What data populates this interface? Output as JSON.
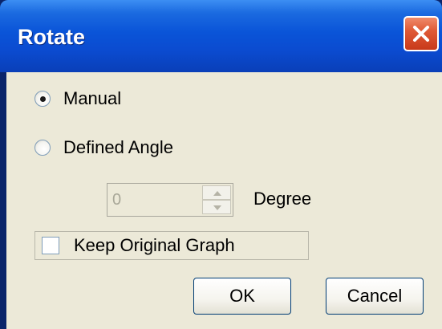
{
  "window": {
    "title": "Rotate",
    "close_icon": "close-x-icon",
    "accent_color": "#0a54d8",
    "close_color": "#e05a36"
  },
  "mode": {
    "options": [
      {
        "label": "Manual",
        "selected": true
      },
      {
        "label": "Defined Angle",
        "selected": false
      }
    ]
  },
  "angle": {
    "value": "0",
    "unit_label": "Degree",
    "enabled": false,
    "up_icon": "spin-up-arrow-icon",
    "down_icon": "spin-down-arrow-icon"
  },
  "keep_original": {
    "label": "Keep Original Graph",
    "checked": false
  },
  "buttons": {
    "ok_label": "OK",
    "cancel_label": "Cancel"
  }
}
